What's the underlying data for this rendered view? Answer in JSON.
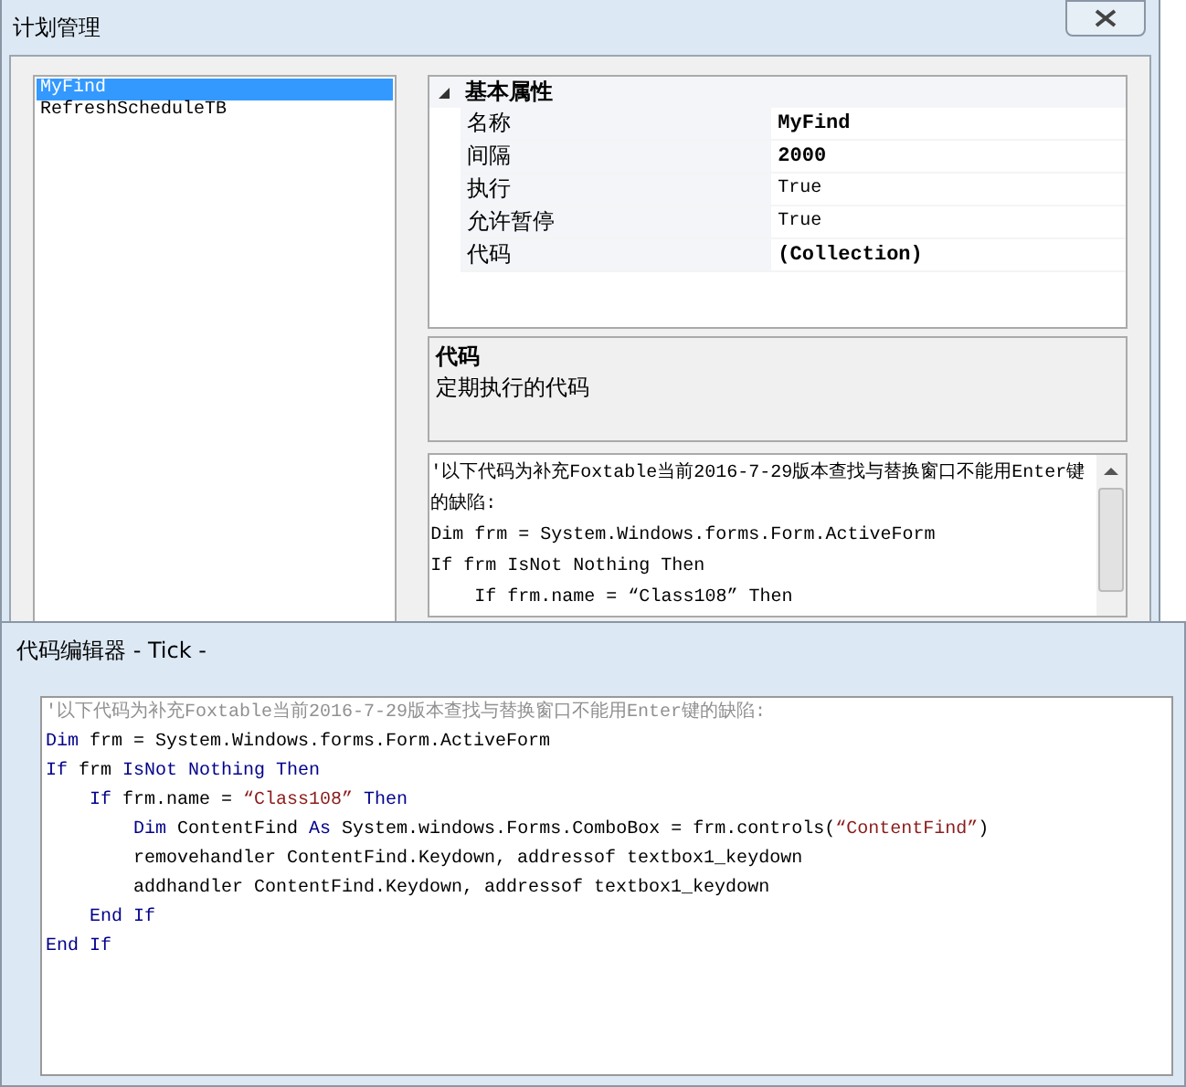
{
  "window": {
    "title": "计划管理"
  },
  "plans": [
    {
      "label": "MyFind",
      "selected": true
    },
    {
      "label": "RefreshScheduleTB",
      "selected": false
    }
  ],
  "properties": {
    "category": "基本属性",
    "expanded": true,
    "rows": [
      {
        "name": "名称",
        "value": "MyFind",
        "bold": true
      },
      {
        "name": "间隔",
        "value": "2000",
        "bold": true
      },
      {
        "name": "执行",
        "value": "True",
        "bold": false
      },
      {
        "name": "允许暂停",
        "value": "True",
        "bold": false
      },
      {
        "name": "代码",
        "value": "(Collection)",
        "bold": true
      }
    ]
  },
  "description": {
    "title": "代码",
    "text": "定期执行的代码"
  },
  "code_preview": [
    "'以下代码为补充Foxtable当前2016-7-29版本查找与替换窗口不能用Enter键的缺陷:",
    "Dim frm = System.Windows.forms.Form.ActiveForm",
    "If frm IsNot Nothing Then",
    "    If frm.name = “Class108” Then"
  ],
  "editor": {
    "title": "代码编辑器 - Tick -",
    "lines": [
      [
        {
          "kind": "comment",
          "text": "'以下代码为补充Foxtable当前2016-7-29版本查找与替换窗口不能用Enter键的缺陷:"
        }
      ],
      [
        {
          "kind": "keyword",
          "text": "Dim"
        },
        {
          "kind": "plain",
          "text": " frm = System.Windows.forms.Form.ActiveForm"
        }
      ],
      [
        {
          "kind": "keyword",
          "text": "If"
        },
        {
          "kind": "plain",
          "text": " frm "
        },
        {
          "kind": "keyword",
          "text": "IsNot Nothing Then"
        }
      ],
      [
        {
          "kind": "keyword",
          "text": "    If"
        },
        {
          "kind": "plain",
          "text": " frm.name = "
        },
        {
          "kind": "string",
          "text": "“Class108”"
        },
        {
          "kind": "keyword",
          "text": " Then"
        }
      ],
      [
        {
          "kind": "keyword",
          "text": "        Dim"
        },
        {
          "kind": "plain",
          "text": " ContentFind "
        },
        {
          "kind": "keyword",
          "text": "As"
        },
        {
          "kind": "plain",
          "text": " System.windows.Forms.ComboBox = frm.controls("
        },
        {
          "kind": "string",
          "text": "“ContentFind”"
        },
        {
          "kind": "plain",
          "text": ")"
        }
      ],
      [
        {
          "kind": "plain",
          "text": "        removehandler ContentFind.Keydown, addressof textbox1_keydown"
        }
      ],
      [
        {
          "kind": "plain",
          "text": "        addhandler ContentFind.Keydown, addressof textbox1_keydown"
        }
      ],
      [
        {
          "kind": "keyword",
          "text": "    End If"
        }
      ],
      [
        {
          "kind": "keyword",
          "text": "End If"
        }
      ]
    ]
  }
}
